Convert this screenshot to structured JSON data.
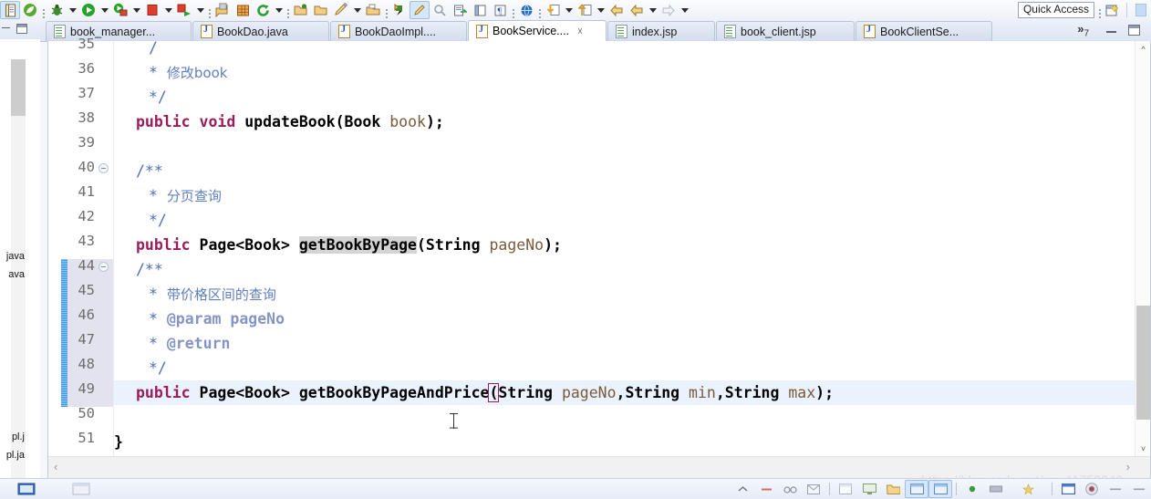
{
  "toolbar": {
    "quick_access_label": "Quick Access",
    "icons": [
      {
        "name": "new-wizard-icon"
      },
      {
        "name": "spring-leaf-icon"
      },
      {
        "name": "debug-bug-icon"
      },
      {
        "name": "run-play-icon"
      },
      {
        "name": "run-external-tools-icon"
      },
      {
        "name": "terminate-stop-icon"
      },
      {
        "name": "run-server-icon"
      },
      {
        "name": "new-jsp-icon"
      },
      {
        "name": "new-table-icon"
      },
      {
        "name": "refresh-green-icon"
      },
      {
        "name": "open-folder-icon"
      },
      {
        "name": "open-folder2-icon"
      },
      {
        "name": "brush-icon"
      },
      {
        "name": "open-type-icon"
      },
      {
        "name": "pin-icon"
      },
      {
        "name": "paint-active-icon"
      },
      {
        "name": "search-gray-icon"
      },
      {
        "name": "export-icon"
      },
      {
        "name": "book-icon"
      },
      {
        "name": "paragraph-icon"
      },
      {
        "name": "globe-icon"
      },
      {
        "name": "download-icon"
      },
      {
        "name": "up-arrow-icon"
      },
      {
        "name": "back-arrow-icon"
      },
      {
        "name": "back-arrow2-icon"
      },
      {
        "name": "forward-arrow-icon"
      }
    ]
  },
  "left_panel": {
    "labels": [
      "java",
      "ava",
      "pl.j",
      "pl.ja"
    ]
  },
  "tabs": [
    {
      "label": "book_manager...",
      "type": "jsp",
      "active": false,
      "closeable": false
    },
    {
      "label": "BookDao.java",
      "type": "java",
      "active": false,
      "closeable": false
    },
    {
      "label": "BookDaoImpl....",
      "type": "java",
      "active": false,
      "closeable": false
    },
    {
      "label": "BookService....",
      "type": "java",
      "active": true,
      "closeable": true
    },
    {
      "label": "index.jsp",
      "type": "jsp",
      "active": false,
      "closeable": false
    },
    {
      "label": "book_client.jsp",
      "type": "jsp",
      "active": false,
      "closeable": false
    },
    {
      "label": "BookClientSe...",
      "type": "java",
      "active": false,
      "closeable": false
    }
  ],
  "tab_overflow": {
    "chevron": "»",
    "count": "7"
  },
  "editor": {
    "first_visible_line": 35,
    "highlighted_line": 49,
    "change_bar_lines": [
      44,
      45,
      46,
      47,
      48,
      49
    ],
    "selected_gutter_lines": [
      44,
      45,
      46,
      47,
      48,
      49
    ],
    "fold_lines": [
      40,
      44
    ],
    "lines": [
      {
        "no": "35",
        "text": " /"
      },
      {
        "no": "36",
        "text": "  * 修改book"
      },
      {
        "no": "37",
        "text": "  */"
      },
      {
        "no": "38",
        "text": " public void updateBook(Book book);"
      },
      {
        "no": "39",
        "text": ""
      },
      {
        "no": "40",
        "text": " /**"
      },
      {
        "no": "41",
        "text": "  * 分页查询"
      },
      {
        "no": "42",
        "text": "  */"
      },
      {
        "no": "43",
        "text": " public Page<Book> getBookByPage(String pageNo);"
      },
      {
        "no": "44",
        "text": " /**"
      },
      {
        "no": "45",
        "text": "  * 带价格区间的查询"
      },
      {
        "no": "46",
        "text": "  * @param pageNo"
      },
      {
        "no": "47",
        "text": "  * @return"
      },
      {
        "no": "48",
        "text": "  */"
      },
      {
        "no": "49",
        "text": " public Page<Book> getBookByPageAndPrice(String pageNo,String min,String max);"
      },
      {
        "no": "50",
        "text": ""
      },
      {
        "no": "51",
        "text": "}"
      }
    ],
    "tokens": {
      "kw_public": "public",
      "kw_void": "void",
      "type_page": "Page<Book>",
      "type_book": "Book",
      "type_string": "String",
      "m_updateBook": "updateBook",
      "m_getBookByPage": "getBookByPage",
      "m_getBookByPageAndPrice": "getBookByPageAndPrice",
      "p_book": "book",
      "p_pageNo": "pageNo",
      "p_min": "min",
      "p_max": "max",
      "cm_modify_book": "修改book",
      "cm_page_query": "分页查询",
      "cm_price_range_query": "带价格区间的查询",
      "cm_param": "@param",
      "cm_return": "@return",
      "star": "*",
      "star_open": "/**",
      "star_close": "*/",
      "slash": "/",
      "brace_close": "}",
      "lparen": "(",
      "rparen": ")",
      "semi": ";",
      "comma": ","
    },
    "hscroll_left": "‹",
    "hscroll_right": "›"
  },
  "watermark": "https://blog.csdn.net/qq_41753340",
  "taskbar": {
    "icons": [
      {
        "name": "up-chevron-icon"
      },
      {
        "name": "minus-red-icon"
      },
      {
        "name": "glasses-icon"
      },
      {
        "name": "mail-icon"
      },
      {
        "name": "window-icon"
      },
      {
        "name": "monitor-icon"
      },
      {
        "name": "folder-icon"
      },
      {
        "name": "ie-window-icon"
      },
      {
        "name": "ie-window2-icon"
      },
      {
        "name": "green-dot-icon"
      },
      {
        "name": "gray-box-icon"
      },
      {
        "name": "star-icon"
      },
      {
        "name": "blue-window-icon"
      },
      {
        "name": "chrome-icon"
      },
      {
        "name": "dash-icon"
      },
      {
        "name": "dash2-icon"
      }
    ]
  }
}
